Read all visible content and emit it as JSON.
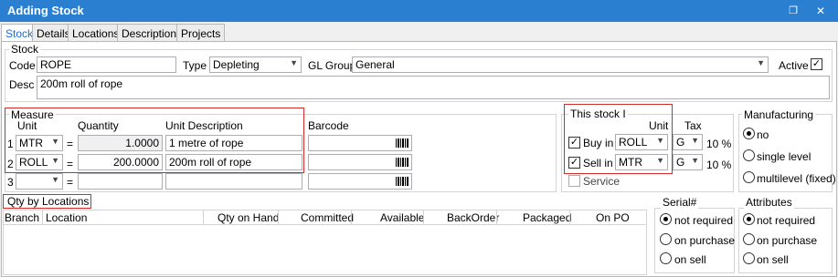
{
  "window": {
    "title": "Adding Stock"
  },
  "tabs": [
    {
      "label": "Stock"
    },
    {
      "label": "Details"
    },
    {
      "label": "Locations"
    },
    {
      "label": "Descriptions"
    },
    {
      "label": "Projects"
    }
  ],
  "stock": {
    "group_label": "Stock",
    "code_label": "Code",
    "code_value": "ROPE",
    "type_label": "Type",
    "type_value": "Depleting",
    "glgroup_label": "GL Group",
    "glgroup_value": "General",
    "active_label": "Active",
    "desc_label": "Desc",
    "desc_value": "200m roll of rope"
  },
  "measure": {
    "group_label": "Measure",
    "col_unit": "Unit",
    "col_quantity": "Quantity",
    "col_unit_desc": "Unit Description",
    "col_barcode": "Barcode",
    "rows": [
      {
        "num": "1",
        "unit": "MTR",
        "eq": "=",
        "quantity": "1.0000",
        "desc": "1 metre of rope"
      },
      {
        "num": "2",
        "unit": "ROLL",
        "eq": "=",
        "quantity": "200.0000",
        "desc": "200m roll of rope"
      },
      {
        "num": "3",
        "unit": "",
        "eq": "=",
        "quantity": "",
        "desc": ""
      }
    ]
  },
  "this_stock": {
    "group_label": "This stock I",
    "col_unit": "Unit",
    "col_tax": "Tax",
    "buy_label": "Buy in",
    "buy_unit": "ROLL",
    "buy_tax": "G",
    "buy_pct": "10 %",
    "sell_label": "Sell in",
    "sell_unit": "MTR",
    "sell_tax": "G",
    "sell_pct": "10 %",
    "service_label": "Service"
  },
  "manufacturing": {
    "group_label": "Manufacturing",
    "options": [
      {
        "label": "no"
      },
      {
        "label": "single level"
      },
      {
        "label": "multilevel (fixed)"
      }
    ]
  },
  "qty_by_locations": {
    "label": "Qty by Locations",
    "columns": [
      "Branch",
      "Location",
      "Qty on Hand",
      "Committed",
      "Available",
      "BackOrder",
      "Packaged",
      "On PO"
    ]
  },
  "serial": {
    "group_label": "Serial#",
    "options": [
      {
        "label": "not required"
      },
      {
        "label": "on purchase"
      },
      {
        "label": "on sell"
      }
    ]
  },
  "attributes": {
    "group_label": "Attributes",
    "options": [
      {
        "label": "not required"
      },
      {
        "label": "on purchase"
      },
      {
        "label": "on sell"
      }
    ]
  }
}
